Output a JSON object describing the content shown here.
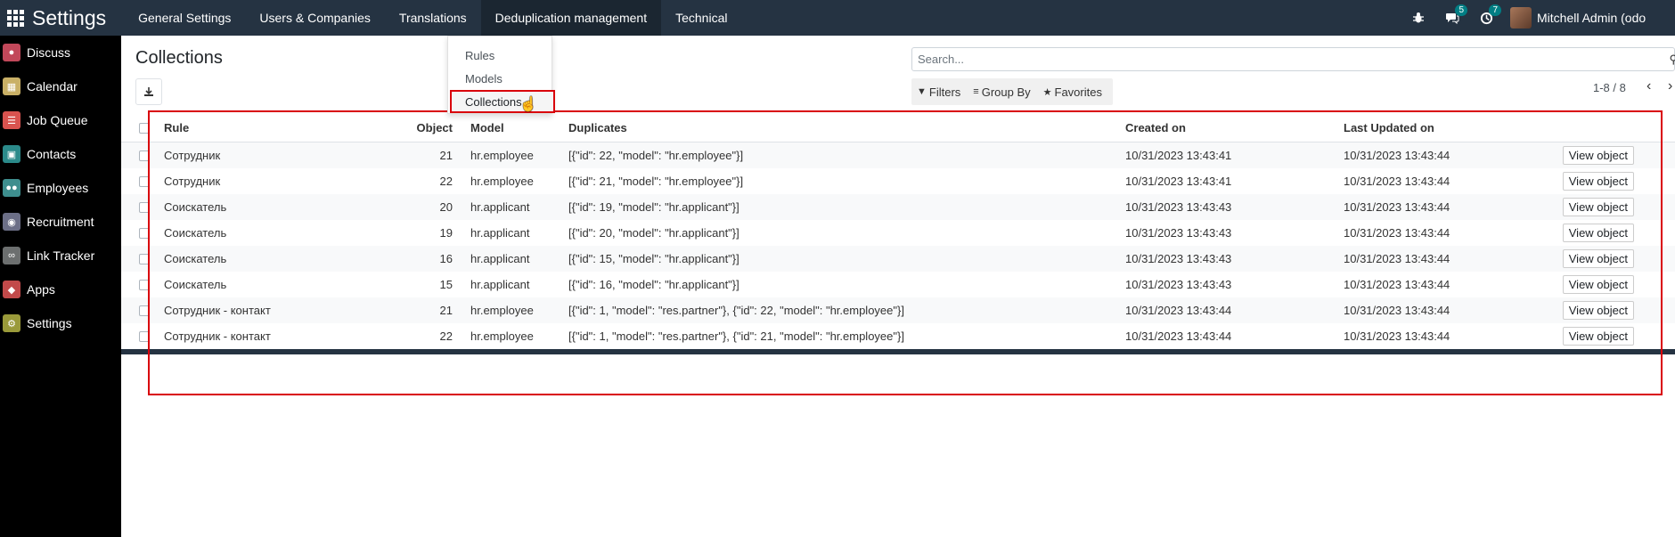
{
  "app_title": "Settings",
  "topnav": [
    "General Settings",
    "Users & Companies",
    "Translations",
    "Deduplication management",
    "Technical"
  ],
  "topright": {
    "messages_badge": "5",
    "activities_badge": "7",
    "user_name": "Mitchell Admin (odo"
  },
  "sidebar": [
    {
      "label": "Discuss",
      "color": "#c2485a",
      "icon": "chat-icon"
    },
    {
      "label": "Calendar",
      "color": "#c9b066",
      "icon": "calendar-icon"
    },
    {
      "label": "Job Queue",
      "color": "#d9534f",
      "icon": "list-icon"
    },
    {
      "label": "Contacts",
      "color": "#2b8a8a",
      "icon": "contacts-icon"
    },
    {
      "label": "Employees",
      "color": "#3e8e8e",
      "icon": "people-icon"
    },
    {
      "label": "Recruitment",
      "color": "#6c6f87",
      "icon": "search-person-icon"
    },
    {
      "label": "Link Tracker",
      "color": "#6c6f6f",
      "icon": "link-icon"
    },
    {
      "label": "Apps",
      "color": "#c24a4a",
      "icon": "apps-icon"
    },
    {
      "label": "Settings",
      "color": "#9a9a3a",
      "icon": "gear-icon"
    }
  ],
  "page_title": "Collections",
  "search": {
    "placeholder": "Search..."
  },
  "filters": {
    "filters_label": "Filters",
    "groupby_label": "Group By",
    "favorites_label": "Favorites"
  },
  "pager": "1-8 / 8",
  "dropdown": [
    "Rules",
    "Models",
    "Collections"
  ],
  "table": {
    "headers": {
      "rule": "Rule",
      "object": "Object",
      "model": "Model",
      "duplicates": "Duplicates",
      "created": "Created on",
      "updated": "Last Updated on"
    },
    "rows": [
      {
        "rule": "Сотрудник",
        "object": "21",
        "model": "hr.employee",
        "duplicates": "[{\"id\": 22, \"model\": \"hr.employee\"}]",
        "created": "10/31/2023 13:43:41",
        "updated": "10/31/2023 13:43:44",
        "action": "View object"
      },
      {
        "rule": "Сотрудник",
        "object": "22",
        "model": "hr.employee",
        "duplicates": "[{\"id\": 21, \"model\": \"hr.employee\"}]",
        "created": "10/31/2023 13:43:41",
        "updated": "10/31/2023 13:43:44",
        "action": "View object"
      },
      {
        "rule": "Соискатель",
        "object": "20",
        "model": "hr.applicant",
        "duplicates": "[{\"id\": 19, \"model\": \"hr.applicant\"}]",
        "created": "10/31/2023 13:43:43",
        "updated": "10/31/2023 13:43:44",
        "action": "View object"
      },
      {
        "rule": "Соискатель",
        "object": "19",
        "model": "hr.applicant",
        "duplicates": "[{\"id\": 20, \"model\": \"hr.applicant\"}]",
        "created": "10/31/2023 13:43:43",
        "updated": "10/31/2023 13:43:44",
        "action": "View object"
      },
      {
        "rule": "Соискатель",
        "object": "16",
        "model": "hr.applicant",
        "duplicates": "[{\"id\": 15, \"model\": \"hr.applicant\"}]",
        "created": "10/31/2023 13:43:43",
        "updated": "10/31/2023 13:43:44",
        "action": "View object"
      },
      {
        "rule": "Соискатель",
        "object": "15",
        "model": "hr.applicant",
        "duplicates": "[{\"id\": 16, \"model\": \"hr.applicant\"}]",
        "created": "10/31/2023 13:43:43",
        "updated": "10/31/2023 13:43:44",
        "action": "View object"
      },
      {
        "rule": "Сотрудник - контакт",
        "object": "21",
        "model": "hr.employee",
        "duplicates": "[{\"id\": 1, \"model\": \"res.partner\"}, {\"id\": 22, \"model\": \"hr.employee\"}]",
        "created": "10/31/2023 13:43:44",
        "updated": "10/31/2023 13:43:44",
        "action": "View object"
      },
      {
        "rule": "Сотрудник - контакт",
        "object": "22",
        "model": "hr.employee",
        "duplicates": "[{\"id\": 1, \"model\": \"res.partner\"}, {\"id\": 21, \"model\": \"hr.employee\"}]",
        "created": "10/31/2023 13:43:44",
        "updated": "10/31/2023 13:43:44",
        "action": "View object"
      }
    ]
  }
}
